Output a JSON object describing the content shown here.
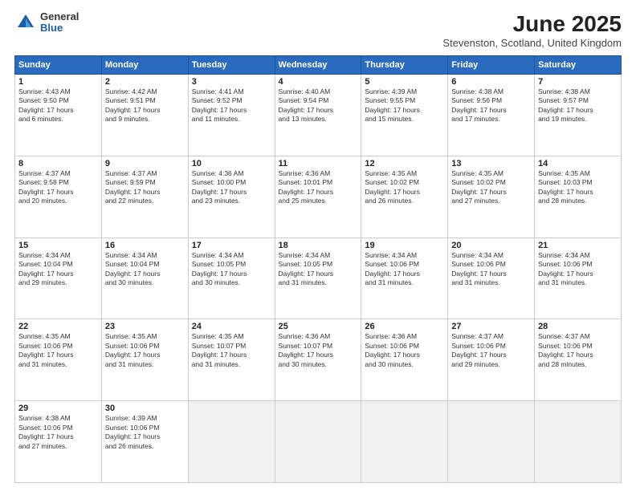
{
  "header": {
    "logo_general": "General",
    "logo_blue": "Blue",
    "month": "June 2025",
    "location": "Stevenston, Scotland, United Kingdom"
  },
  "weekdays": [
    "Sunday",
    "Monday",
    "Tuesday",
    "Wednesday",
    "Thursday",
    "Friday",
    "Saturday"
  ],
  "rows": [
    [
      {
        "day": "1",
        "lines": [
          "Sunrise: 4:43 AM",
          "Sunset: 9:50 PM",
          "Daylight: 17 hours",
          "and 6 minutes."
        ]
      },
      {
        "day": "2",
        "lines": [
          "Sunrise: 4:42 AM",
          "Sunset: 9:51 PM",
          "Daylight: 17 hours",
          "and 9 minutes."
        ]
      },
      {
        "day": "3",
        "lines": [
          "Sunrise: 4:41 AM",
          "Sunset: 9:52 PM",
          "Daylight: 17 hours",
          "and 11 minutes."
        ]
      },
      {
        "day": "4",
        "lines": [
          "Sunrise: 4:40 AM",
          "Sunset: 9:54 PM",
          "Daylight: 17 hours",
          "and 13 minutes."
        ]
      },
      {
        "day": "5",
        "lines": [
          "Sunrise: 4:39 AM",
          "Sunset: 9:55 PM",
          "Daylight: 17 hours",
          "and 15 minutes."
        ]
      },
      {
        "day": "6",
        "lines": [
          "Sunrise: 4:38 AM",
          "Sunset: 9:56 PM",
          "Daylight: 17 hours",
          "and 17 minutes."
        ]
      },
      {
        "day": "7",
        "lines": [
          "Sunrise: 4:38 AM",
          "Sunset: 9:57 PM",
          "Daylight: 17 hours",
          "and 19 minutes."
        ]
      }
    ],
    [
      {
        "day": "8",
        "lines": [
          "Sunrise: 4:37 AM",
          "Sunset: 9:58 PM",
          "Daylight: 17 hours",
          "and 20 minutes."
        ]
      },
      {
        "day": "9",
        "lines": [
          "Sunrise: 4:37 AM",
          "Sunset: 9:59 PM",
          "Daylight: 17 hours",
          "and 22 minutes."
        ]
      },
      {
        "day": "10",
        "lines": [
          "Sunrise: 4:36 AM",
          "Sunset: 10:00 PM",
          "Daylight: 17 hours",
          "and 23 minutes."
        ]
      },
      {
        "day": "11",
        "lines": [
          "Sunrise: 4:36 AM",
          "Sunset: 10:01 PM",
          "Daylight: 17 hours",
          "and 25 minutes."
        ]
      },
      {
        "day": "12",
        "lines": [
          "Sunrise: 4:35 AM",
          "Sunset: 10:02 PM",
          "Daylight: 17 hours",
          "and 26 minutes."
        ]
      },
      {
        "day": "13",
        "lines": [
          "Sunrise: 4:35 AM",
          "Sunset: 10:02 PM",
          "Daylight: 17 hours",
          "and 27 minutes."
        ]
      },
      {
        "day": "14",
        "lines": [
          "Sunrise: 4:35 AM",
          "Sunset: 10:03 PM",
          "Daylight: 17 hours",
          "and 28 minutes."
        ]
      }
    ],
    [
      {
        "day": "15",
        "lines": [
          "Sunrise: 4:34 AM",
          "Sunset: 10:04 PM",
          "Daylight: 17 hours",
          "and 29 minutes."
        ]
      },
      {
        "day": "16",
        "lines": [
          "Sunrise: 4:34 AM",
          "Sunset: 10:04 PM",
          "Daylight: 17 hours",
          "and 30 minutes."
        ]
      },
      {
        "day": "17",
        "lines": [
          "Sunrise: 4:34 AM",
          "Sunset: 10:05 PM",
          "Daylight: 17 hours",
          "and 30 minutes."
        ]
      },
      {
        "day": "18",
        "lines": [
          "Sunrise: 4:34 AM",
          "Sunset: 10:05 PM",
          "Daylight: 17 hours",
          "and 31 minutes."
        ]
      },
      {
        "day": "19",
        "lines": [
          "Sunrise: 4:34 AM",
          "Sunset: 10:06 PM",
          "Daylight: 17 hours",
          "and 31 minutes."
        ]
      },
      {
        "day": "20",
        "lines": [
          "Sunrise: 4:34 AM",
          "Sunset: 10:06 PM",
          "Daylight: 17 hours",
          "and 31 minutes."
        ]
      },
      {
        "day": "21",
        "lines": [
          "Sunrise: 4:34 AM",
          "Sunset: 10:06 PM",
          "Daylight: 17 hours",
          "and 31 minutes."
        ]
      }
    ],
    [
      {
        "day": "22",
        "lines": [
          "Sunrise: 4:35 AM",
          "Sunset: 10:06 PM",
          "Daylight: 17 hours",
          "and 31 minutes."
        ]
      },
      {
        "day": "23",
        "lines": [
          "Sunrise: 4:35 AM",
          "Sunset: 10:06 PM",
          "Daylight: 17 hours",
          "and 31 minutes."
        ]
      },
      {
        "day": "24",
        "lines": [
          "Sunrise: 4:35 AM",
          "Sunset: 10:07 PM",
          "Daylight: 17 hours",
          "and 31 minutes."
        ]
      },
      {
        "day": "25",
        "lines": [
          "Sunrise: 4:36 AM",
          "Sunset: 10:07 PM",
          "Daylight: 17 hours",
          "and 30 minutes."
        ]
      },
      {
        "day": "26",
        "lines": [
          "Sunrise: 4:36 AM",
          "Sunset: 10:06 PM",
          "Daylight: 17 hours",
          "and 30 minutes."
        ]
      },
      {
        "day": "27",
        "lines": [
          "Sunrise: 4:37 AM",
          "Sunset: 10:06 PM",
          "Daylight: 17 hours",
          "and 29 minutes."
        ]
      },
      {
        "day": "28",
        "lines": [
          "Sunrise: 4:37 AM",
          "Sunset: 10:06 PM",
          "Daylight: 17 hours",
          "and 28 minutes."
        ]
      }
    ],
    [
      {
        "day": "29",
        "lines": [
          "Sunrise: 4:38 AM",
          "Sunset: 10:06 PM",
          "Daylight: 17 hours",
          "and 27 minutes."
        ]
      },
      {
        "day": "30",
        "lines": [
          "Sunrise: 4:39 AM",
          "Sunset: 10:06 PM",
          "Daylight: 17 hours",
          "and 26 minutes."
        ]
      },
      null,
      null,
      null,
      null,
      null
    ]
  ]
}
